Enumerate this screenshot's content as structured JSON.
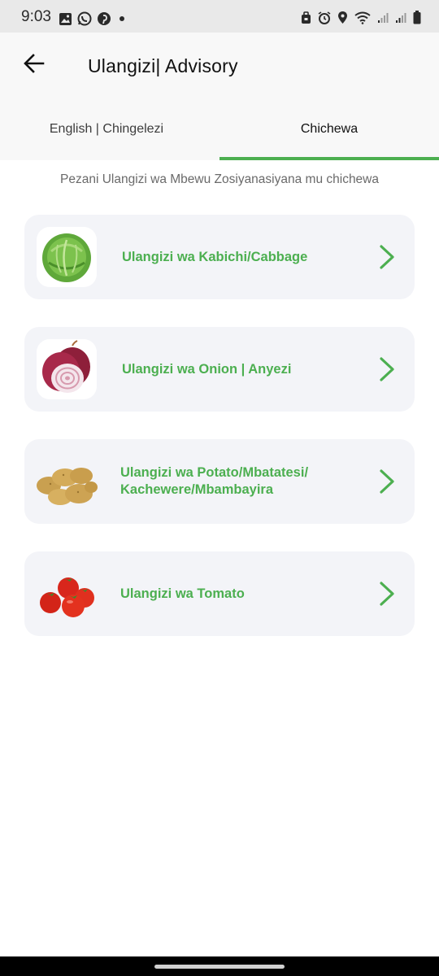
{
  "status_bar": {
    "time": "9:03",
    "left_icons": [
      "gallery-icon",
      "whatsapp-icon",
      "pinterest-icon",
      "dot-icon"
    ],
    "right_icons": [
      "lock-icon",
      "alarm-icon",
      "location-icon",
      "wifi-icon",
      "signal-icon",
      "signal-icon",
      "battery-icon"
    ]
  },
  "app_bar": {
    "back_icon": "arrow-left-icon",
    "title": "Ulangizi| Advisory"
  },
  "tabs": [
    {
      "label": "English | Chingelezi",
      "selected": false
    },
    {
      "label": "Chichewa",
      "selected": true
    }
  ],
  "subtitle": "Pezani Ulangizi wa Mbewu Zosiyanasiyana mu chichewa",
  "cards": [
    {
      "label": "Ulangizi wa Kabichi/Cabbage",
      "image": "cabbage-image"
    },
    {
      "label": "Ulangizi wa Onion | Anyezi",
      "image": "onion-image"
    },
    {
      "label": "Ulangizi wa Potato/Mbatatesi/ Kachewere/Mbambayira",
      "image": "potato-image"
    },
    {
      "label": "Ulangizi wa Tomato",
      "image": "tomato-image"
    }
  ],
  "colors": {
    "accent": "#4caf50",
    "card_background": "#f3f4f8",
    "app_bar_background": "#f8f8f8"
  }
}
